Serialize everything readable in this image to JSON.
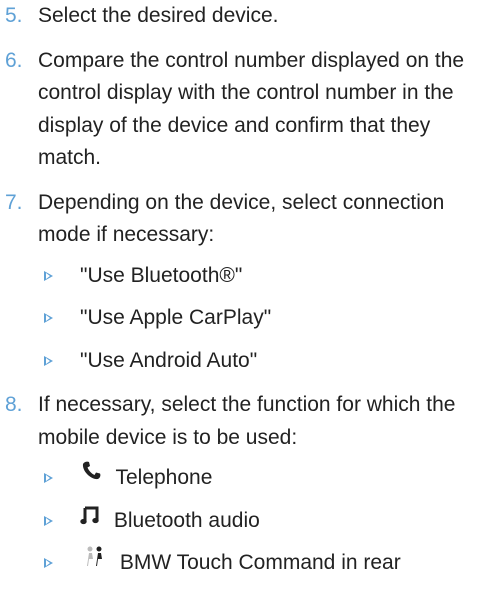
{
  "colors": {
    "accent": "#5fa1d6",
    "text": "#222222"
  },
  "steps": [
    {
      "number": "5.",
      "text": "Select the desired device."
    },
    {
      "number": "6.",
      "text": "Compare the control number displayed on the control display with the control number in the display of the device and confirm that they match."
    },
    {
      "number": "7.",
      "text": "Depending on the device, select connection mode if necessary:",
      "items": [
        {
          "text": "\"Use Bluetooth®\""
        },
        {
          "text": "\"Use Apple CarPlay\""
        },
        {
          "text": "\"Use Android Auto\""
        }
      ]
    },
    {
      "number": "8.",
      "text": "If necessary, select the function for which the mobile device is to be used:",
      "items": [
        {
          "icon": "telephone-icon",
          "text": "Telephone"
        },
        {
          "icon": "music-note-icon",
          "text": "Bluetooth audio"
        },
        {
          "icon": "rear-passengers-icon",
          "text": "BMW Touch Command in rear"
        }
      ]
    }
  ]
}
